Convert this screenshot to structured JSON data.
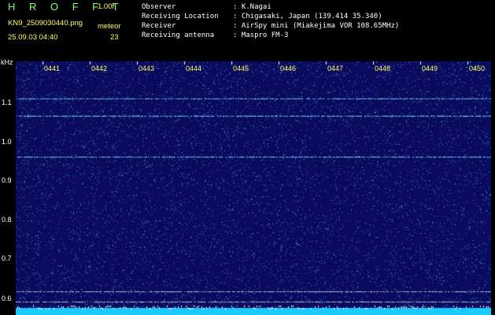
{
  "header": {
    "logo": "H R O F F T",
    "version": "1.00f",
    "filename": "KN9_2509030440.png",
    "meteor_label": "meteor",
    "datetime": "25.09.03 04:40",
    "meteor_count": "23"
  },
  "info": {
    "observer_key": "Observer",
    "observer_val": ": K.Nagai",
    "location_key": "Receiving Location",
    "location_val": ": Chigasaki, Japan (139.414 35.340)",
    "receiver_key": "Receiver",
    "receiver_val": ": AirSpy mini (Miakejima VOR 108.65MHz)",
    "antenna_key": "Receiving antenna",
    "antenna_val": ": Maspro FM-3"
  },
  "plot": {
    "y_unit": "kHz",
    "y_labels": [
      "1.1",
      "1.0",
      "0.9",
      "0.8",
      "0.7",
      "0.6"
    ],
    "time_labels": [
      "0441",
      "0442",
      "0443",
      "0444",
      "0445",
      "0446",
      "0447",
      "0448",
      "0449",
      "0450"
    ],
    "colors": {
      "background": "#0b0b5e",
      "noise": "#3a7bd5",
      "noise_bright": "#5fd0ff",
      "tone": "#7ff2ff",
      "line": "#d7e8ff",
      "baseline": "#19c9ff"
    }
  }
}
